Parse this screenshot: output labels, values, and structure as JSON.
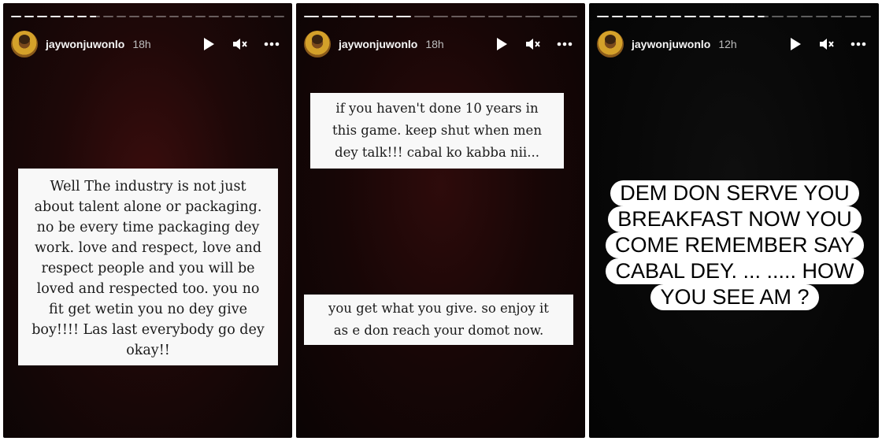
{
  "stories": [
    {
      "username": "jaywonjuwonlo",
      "time": "18h",
      "progress": {
        "full": 6,
        "partial": 1,
        "empty": 14
      },
      "text": "Well The industry is not just\nabout talent  alone or packaging.\nno be every time packaging dey\nwork.  love and respect, love and\nrespect people and you will be\nloved and respected  too.  you no\nfit get wetin you no dey give\nboy!!!! Las last everybody go dey\nokay!!"
    },
    {
      "username": "jaywonjuwonlo",
      "time": "18h",
      "progress": {
        "full": 6,
        "partial": 0,
        "empty": 9
      },
      "text_top": "if you haven't done 10 years in\nthis game.  keep shut when men\ndey talk!!! cabal ko kabba nii...",
      "text_bottom": "you get what you give.  so enjoy it\nas e don reach your domot now."
    },
    {
      "username": "jaywonjuwonlo",
      "time": "12h",
      "progress": {
        "full": 11,
        "partial": 1,
        "empty": 7
      },
      "sticker_lines": [
        "DEM DON SERVE YOU",
        "BREAKFAST NOW YOU",
        "COME REMEMBER SAY",
        "CABAL DEY.  ... ..... HOW",
        "YOU SEE AM ?"
      ]
    }
  ],
  "controls": {
    "play_icon": "play-icon",
    "mute_icon": "speaker-muted-icon",
    "more_icon": "more-horizontal-icon"
  },
  "colors": {
    "text_light": "#f5f5f5",
    "time_gray": "#bdbdbd",
    "box_bg": "#f8f8f8"
  }
}
